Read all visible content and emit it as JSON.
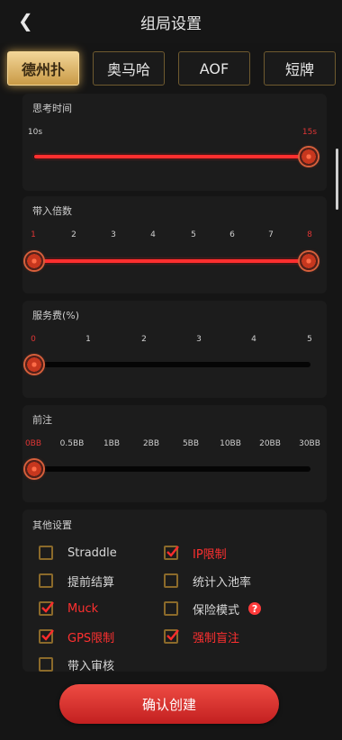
{
  "header": {
    "title": "组局设置"
  },
  "tabs": [
    {
      "label": "德州扑",
      "active": true
    },
    {
      "label": "奥马哈",
      "active": false
    },
    {
      "label": "AOF",
      "active": false
    },
    {
      "label": "短牌",
      "active": false
    }
  ],
  "think_time": {
    "label": "思考时间",
    "min_label": "10s",
    "max_label": "15s",
    "selected": "15s"
  },
  "buy_in": {
    "label": "带入倍数",
    "ticks": [
      "1",
      "2",
      "3",
      "4",
      "5",
      "6",
      "7",
      "8"
    ],
    "range_selected": [
      "1",
      "8"
    ]
  },
  "service_fee": {
    "label": "服务费(%)",
    "ticks": [
      "0",
      "1",
      "2",
      "3",
      "4",
      "5"
    ],
    "selected": "0"
  },
  "ante": {
    "label": "前注",
    "ticks": [
      "0BB",
      "0.5BB",
      "1BB",
      "2BB",
      "5BB",
      "10BB",
      "20BB",
      "30BB"
    ],
    "selected": "0BB"
  },
  "other_settings": {
    "label": "其他设置",
    "options": [
      {
        "label": "Straddle",
        "checked": false
      },
      {
        "label": "IP限制",
        "checked": true
      },
      {
        "label": "提前结算",
        "checked": false
      },
      {
        "label": "统计入池率",
        "checked": false
      },
      {
        "label": "Muck",
        "checked": true
      },
      {
        "label": "保险模式",
        "checked": false
      },
      {
        "label": "GPS限制",
        "checked": true
      },
      {
        "label": "强制盲注",
        "checked": true
      },
      {
        "label": "带入审核",
        "checked": false
      }
    ]
  },
  "confirm_label": "确认创建",
  "colors": {
    "accent": "#ff3030",
    "gold": "#c99a46",
    "background": "#151515"
  }
}
